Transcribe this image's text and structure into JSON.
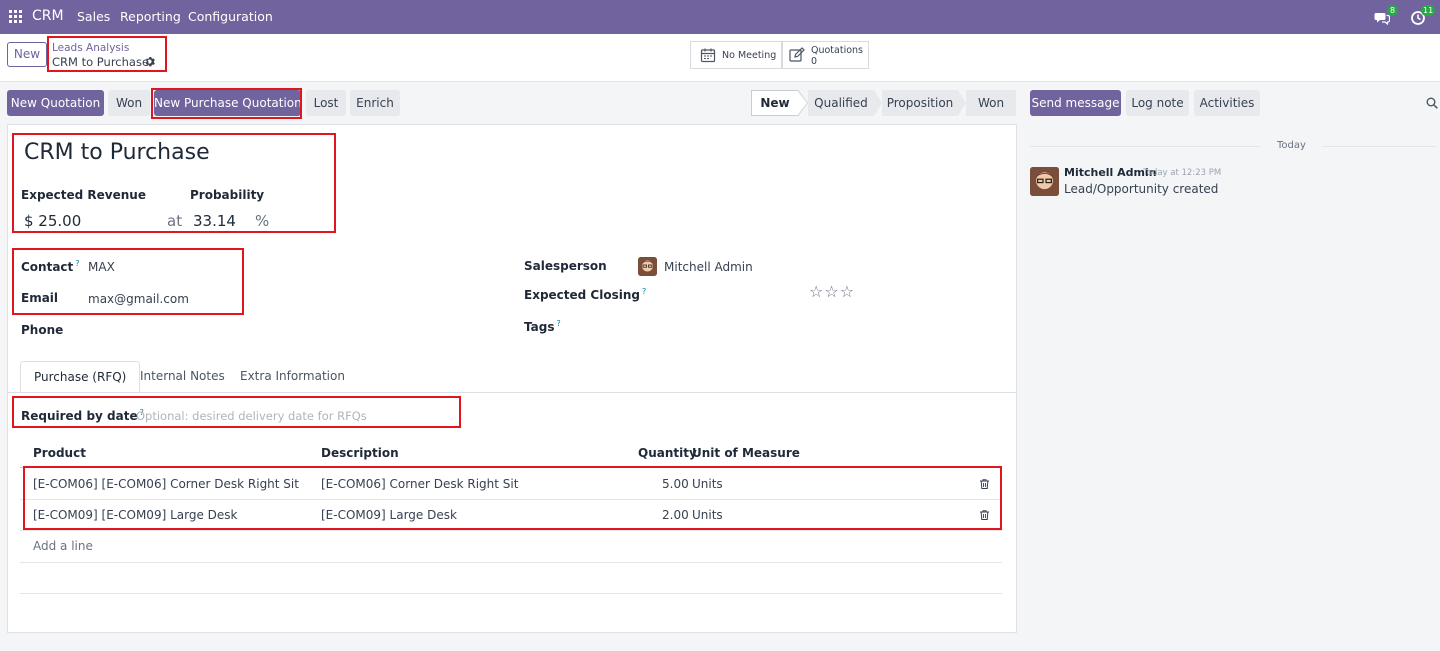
{
  "navbar": {
    "app_name": "CRM",
    "menu": [
      "Sales",
      "Reporting",
      "Configuration"
    ],
    "messages_count": "8",
    "activities_count": "11",
    "color": "#71639e"
  },
  "control": {
    "new_label": "New",
    "breadcrumb_parent": "Leads Analysis",
    "breadcrumb_current": "CRM to Purchase",
    "meeting_label": "No Meeting",
    "quotations_label": "Quotations",
    "quotations_count": "0"
  },
  "actions": {
    "new_quotation": "New Quotation",
    "won": "Won",
    "new_purchase_quotation": "New Purchase Quotation",
    "lost": "Lost",
    "enrich": "Enrich"
  },
  "stages": [
    "New",
    "Qualified",
    "Proposition",
    "Won"
  ],
  "form": {
    "title": "CRM to Purchase",
    "expected_revenue_label": "Expected Revenue",
    "probability_label": "Probability",
    "revenue": "$ 25.00",
    "at": "at",
    "probability": "33.14",
    "percent": "%",
    "contact_label": "Contact",
    "contact": "MAX",
    "email_label": "Email",
    "email": "max@gmail.com",
    "phone_label": "Phone",
    "salesperson_label": "Salesperson",
    "salesperson": "Mitchell Admin",
    "expected_closing_label": "Expected Closing",
    "tags_label": "Tags",
    "help_mark": "?"
  },
  "tabs": [
    "Purchase (RFQ)",
    "Internal Notes",
    "Extra Information"
  ],
  "rfq": {
    "required_label": "Required by date",
    "required_placeholder": "Optional: desired delivery date for RFQs",
    "columns": [
      "Product",
      "Description",
      "Quantity",
      "Unit of Measure"
    ],
    "rows": [
      {
        "product": "[E-COM06] [E-COM06] Corner Desk Right Sit",
        "description": "[E-COM06] Corner Desk Right Sit",
        "quantity": "5.00",
        "uom": "Units"
      },
      {
        "product": "[E-COM09] [E-COM09] Large Desk",
        "description": "[E-COM09] Large Desk",
        "quantity": "2.00",
        "uom": "Units"
      }
    ],
    "add_line": "Add a line"
  },
  "chatter": {
    "send_message": "Send message",
    "log_note": "Log note",
    "activities": "Activities",
    "date_separator": "Today",
    "author": "Mitchell Admin",
    "timestamp": "Today at 12:23 PM",
    "message": "Lead/Opportunity created"
  }
}
